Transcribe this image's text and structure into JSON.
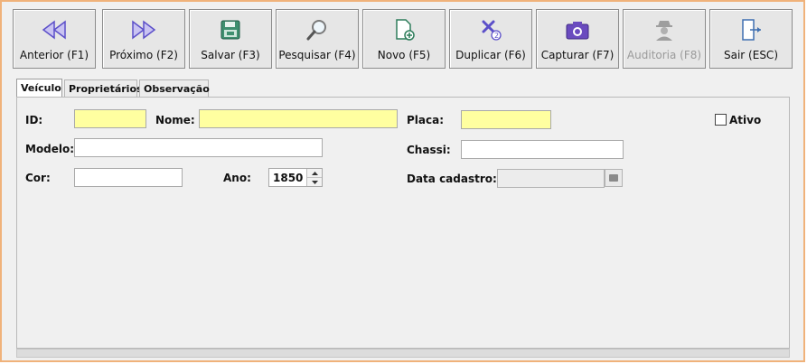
{
  "toolbar": {
    "buttons": [
      {
        "label": "Anterior (F1)",
        "icon": "rewind-icon"
      },
      {
        "label": "Próximo (F2)",
        "icon": "fast-forward-icon"
      },
      {
        "label": "Salvar (F3)",
        "icon": "floppy-disk-icon"
      },
      {
        "label": "Pesquisar (F4)",
        "icon": "magnifier-icon"
      },
      {
        "label": "Novo (F5)",
        "icon": "new-document-icon"
      },
      {
        "label": "Duplicar (F6)",
        "icon": "duplicate-icon"
      },
      {
        "label": "Capturar (F7)",
        "icon": "camera-icon"
      },
      {
        "label": "Auditoria (F8)",
        "icon": "spy-icon",
        "disabled": true
      },
      {
        "label": "Sair (ESC)",
        "icon": "exit-door-icon"
      }
    ]
  },
  "tabs": [
    "Veículo",
    "Proprietários",
    "Observação"
  ],
  "form": {
    "id_label": "ID:",
    "nome_label": "Nome:",
    "placa_label": "Placa:",
    "ativo_label": "Ativo",
    "modelo_label": "Modelo:",
    "chassi_label": "Chassi:",
    "cor_label": "Cor:",
    "ano_label": "Ano:",
    "ano_value": "1850",
    "data_cadastro_label": "Data cadastro:",
    "ativo_checked": false
  },
  "colors": {
    "required_field": "#ffffa0",
    "frame_border": "#f0b27a",
    "icon_purple": "#6a5acd",
    "icon_green": "#2e7d5b"
  }
}
